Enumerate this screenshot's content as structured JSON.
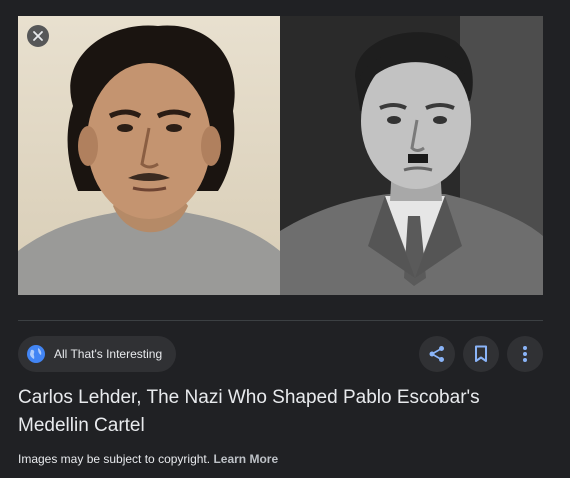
{
  "source": {
    "name": "All That's Interesting",
    "icon": "globe-icon"
  },
  "actions": {
    "share_icon": "share-icon",
    "save_icon": "bookmark-icon",
    "more_icon": "more-vert-icon"
  },
  "title": "Carlos Lehder, The Nazi Who Shaped Pablo Escobar's Medellin Cartel",
  "copyright": {
    "text": "Images may be subject to copyright.",
    "link": "Learn More"
  },
  "colors": {
    "background": "#202124",
    "chip": "#303134",
    "accent": "#8ab4f8",
    "globe": "#4285f4",
    "text": "#e8eaed"
  }
}
